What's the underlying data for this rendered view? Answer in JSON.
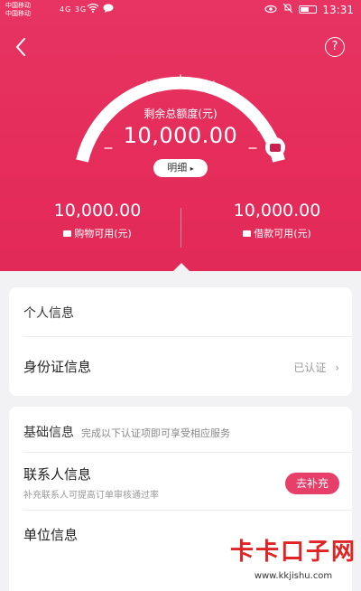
{
  "status_bar": {
    "carrier_1": "中国移动",
    "carrier_2": "中国移动",
    "signal_1": "4G",
    "signal_2": "3G",
    "time": "13:31"
  },
  "header": {
    "back_icon": "chevron-left-icon",
    "help_label": "?"
  },
  "gauge": {
    "title": "剩余总额度(元)",
    "amount": "10,000.00",
    "detail_label": "明细",
    "level": 1.0,
    "accent": "#e73462"
  },
  "limits": [
    {
      "amount": "10,000.00",
      "label": "购物可用(元)",
      "icon": "envelope-icon"
    },
    {
      "amount": "10,000.00",
      "label": "借款可用(元)",
      "icon": "wallet-icon"
    }
  ],
  "personal": {
    "section_title": "个人信息",
    "id_row": {
      "title": "身份证信息",
      "status": "已认证"
    }
  },
  "basic": {
    "section_title": "基础信息",
    "section_note": "完成以下认证项即可享受相应服务",
    "contact_row": {
      "title": "联系人信息",
      "subtitle": "补充联系人可提高订单审核通过率",
      "button_label": "去补充"
    },
    "company_row": {
      "title": "单位信息"
    }
  },
  "watermark": {
    "brand": "卡卡口子网",
    "url": "www.kkjishu.com"
  },
  "colors": {
    "brand_red": "#e73462",
    "button_pink": "#e83f6a",
    "watermark_red": "#e02426"
  }
}
